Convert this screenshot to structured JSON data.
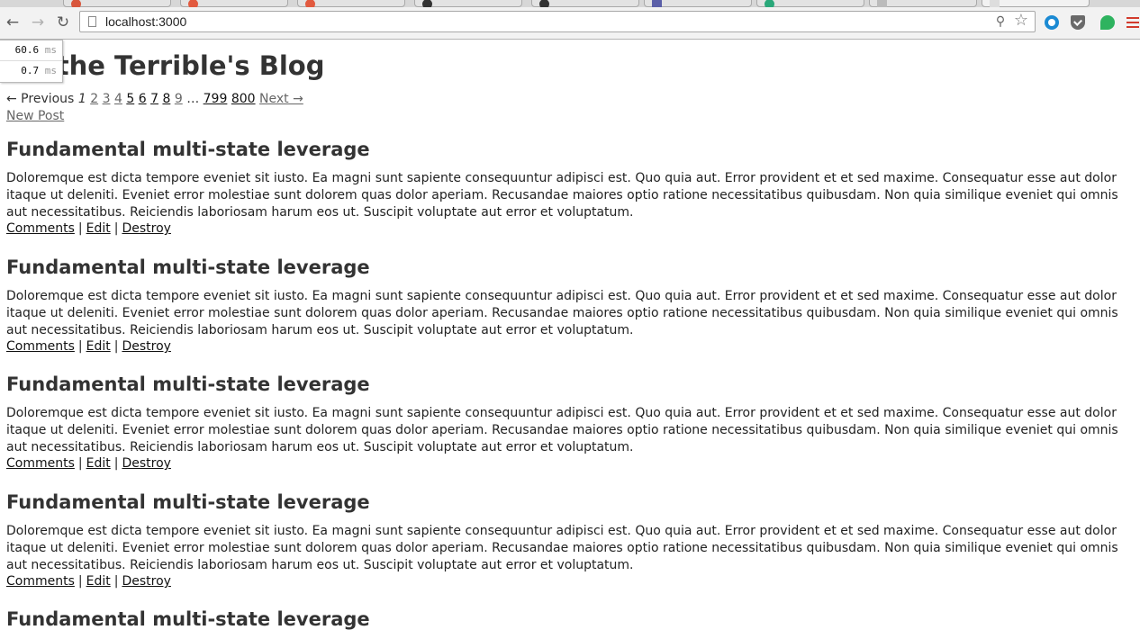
{
  "browser": {
    "url": "localhost:3000"
  },
  "perf": {
    "rows": [
      {
        "value": "60.6",
        "unit": "ms"
      },
      {
        "value": "0.7",
        "unit": "ms"
      }
    ]
  },
  "page": {
    "title": "n the Terrible's Blog",
    "pagination": {
      "previous": "← Previous",
      "current": "1",
      "pages": [
        "2",
        "3",
        "4",
        "5",
        "6",
        "7",
        "8",
        "9"
      ],
      "ellipsis": "…",
      "last_pages": [
        "799",
        "800"
      ],
      "next": "Next →"
    },
    "new_post": "New Post",
    "posts": [
      {
        "title": "Fundamental multi-state leverage",
        "body": "Doloremque est dicta tempore eveniet sit iusto. Ea magni sunt sapiente consequuntur adipisci est. Quo quia aut. Error provident et et sed maxime. Consequatur esse aut dolor itaque ut deleniti. Eveniet error molestiae sunt dolorem quas dolor aperiam. Recusandae maiores optio ratione necessitatibus quibusdam. Non quia similique eveniet qui omnis aut necessitatibus. Reiciendis laboriosam harum eos ut. Suscipit voluptate aut error et voluptatum.",
        "comments": "Comments",
        "edit": "Edit",
        "destroy": "Destroy"
      },
      {
        "title": "Fundamental multi-state leverage",
        "body": "Doloremque est dicta tempore eveniet sit iusto. Ea magni sunt sapiente consequuntur adipisci est. Quo quia aut. Error provident et et sed maxime. Consequatur esse aut dolor itaque ut deleniti. Eveniet error molestiae sunt dolorem quas dolor aperiam. Recusandae maiores optio ratione necessitatibus quibusdam. Non quia similique eveniet qui omnis aut necessitatibus. Reiciendis laboriosam harum eos ut. Suscipit voluptate aut error et voluptatum.",
        "comments": "Comments",
        "edit": "Edit",
        "destroy": "Destroy"
      },
      {
        "title": "Fundamental multi-state leverage",
        "body": "Doloremque est dicta tempore eveniet sit iusto. Ea magni sunt sapiente consequuntur adipisci est. Quo quia aut. Error provident et et sed maxime. Consequatur esse aut dolor itaque ut deleniti. Eveniet error molestiae sunt dolorem quas dolor aperiam. Recusandae maiores optio ratione necessitatibus quibusdam. Non quia similique eveniet qui omnis aut necessitatibus. Reiciendis laboriosam harum eos ut. Suscipit voluptate aut error et voluptatum.",
        "comments": "Comments",
        "edit": "Edit",
        "destroy": "Destroy"
      },
      {
        "title": "Fundamental multi-state leverage",
        "body": "Doloremque est dicta tempore eveniet sit iusto. Ea magni sunt sapiente consequuntur adipisci est. Quo quia aut. Error provident et et sed maxime. Consequatur esse aut dolor itaque ut deleniti. Eveniet error molestiae sunt dolorem quas dolor aperiam. Recusandae maiores optio ratione necessitatibus quibusdam. Non quia similique eveniet qui omnis aut necessitatibus. Reiciendis laboriosam harum eos ut. Suscipit voluptate aut error et voluptatum.",
        "comments": "Comments",
        "edit": "Edit",
        "destroy": "Destroy"
      },
      {
        "title": "Fundamental multi-state leverage"
      }
    ],
    "separator": "|"
  }
}
